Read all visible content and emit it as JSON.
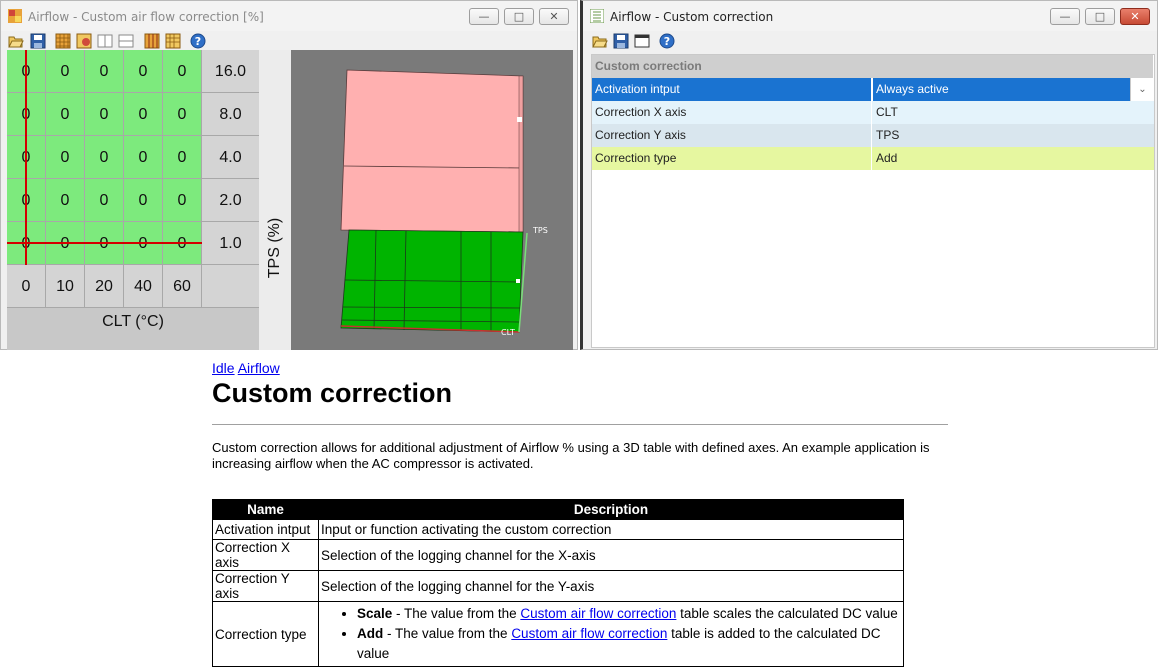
{
  "left_window": {
    "title": "Airflow - Custom air flow correction [%]",
    "buttons": {
      "minimize": "—",
      "maximize": "□",
      "close": "✕"
    },
    "toolbar_icons": [
      "open-icon",
      "save-icon",
      "grid-icon",
      "color-grid-icon",
      "columns-icon",
      "rows-icon",
      "interpolate-icon",
      "smooth-icon",
      "help-icon"
    ],
    "table": {
      "y_axis": [
        "16.0",
        "8.0",
        "4.0",
        "2.0",
        "1.0"
      ],
      "x_axis": [
        "0",
        "10",
        "20",
        "40",
        "60"
      ],
      "values": [
        [
          "0",
          "0",
          "0",
          "0",
          "0"
        ],
        [
          "0",
          "0",
          "0",
          "0",
          "0"
        ],
        [
          "0",
          "0",
          "0",
          "0",
          "0"
        ],
        [
          "0",
          "0",
          "0",
          "0",
          "0"
        ],
        [
          "0",
          "0",
          "0",
          "0",
          "0"
        ]
      ],
      "x_label": "CLT (°C)",
      "y_label": "TPS (%)"
    },
    "plot": {
      "tps_label": "TPS",
      "clt_label": "CLT"
    }
  },
  "right_window": {
    "title": "Airflow - Custom correction",
    "buttons": {
      "minimize": "—",
      "maximize": "□",
      "close": "✕"
    },
    "toolbar_icons": [
      "open-icon",
      "save-icon",
      "window-icon",
      "help-icon"
    ],
    "category": "Custom correction",
    "properties": [
      {
        "key": "Activation intput",
        "value": "Always active"
      },
      {
        "key": "Correction X axis",
        "value": "CLT"
      },
      {
        "key": "Correction Y axis",
        "value": "TPS"
      },
      {
        "key": "Correction type",
        "value": "Add"
      }
    ]
  },
  "doc": {
    "crumb1": "Idle",
    "crumb2": "Airflow",
    "title": "Custom correction",
    "intro": "Custom correction allows for additional adjustment of Airflow % using a 3D table with defined axes. An example application is increasing airflow when the AC compressor is activated.",
    "table": {
      "header_name": "Name",
      "header_desc": "Description",
      "rows": [
        {
          "name": "Activation intput",
          "desc": "Input or function activating the custom correction"
        },
        {
          "name": "Correction X axis",
          "desc": "Selection of the logging channel for the X-axis"
        },
        {
          "name": "Correction Y axis",
          "desc": "Selection of the logging channel for the Y-axis"
        }
      ],
      "type_row": {
        "name": "Correction type",
        "scale_term": "Scale",
        "scale_pre": " - The value from the ",
        "scale_link": "Custom air flow correction",
        "scale_post": " table scales the calculated DC value",
        "add_term": "Add",
        "add_pre": " - The value from the ",
        "add_link": "Custom air flow correction",
        "add_post": " table is added to the calculated DC value"
      }
    }
  },
  "colors": {
    "cell_green": "#7dea7d",
    "plot_green": "#00b400",
    "plot_pink": "#ffb0b0",
    "selection_blue": "#1a73d1",
    "highlight_row": "#e6f7a0",
    "cursor_red": "#d40000"
  }
}
